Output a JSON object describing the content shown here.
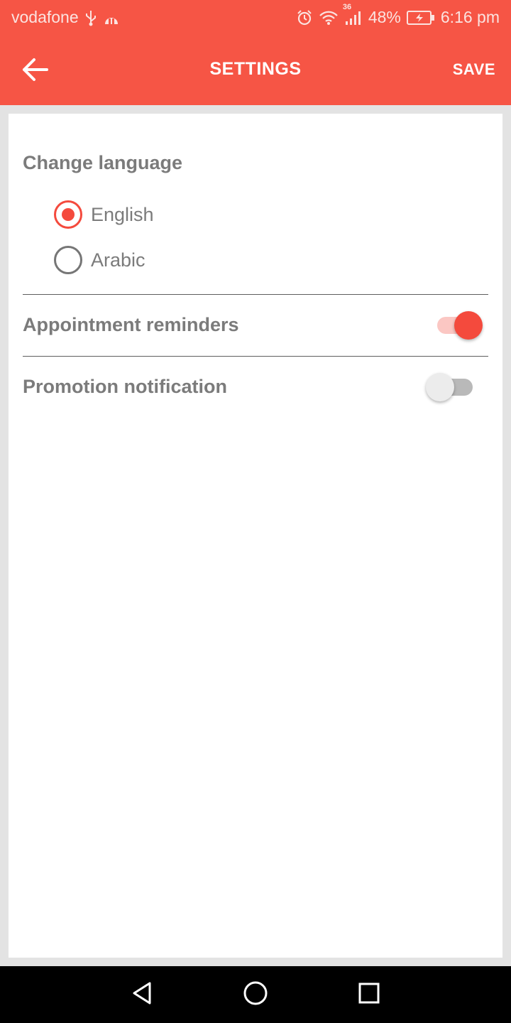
{
  "status_bar": {
    "carrier": "vodafone",
    "network": "36",
    "battery": "48%",
    "time": "6:16 pm",
    "icons": [
      "usb-icon",
      "app-notification-icon",
      "alarm-icon",
      "wifi-icon",
      "signal-icon",
      "battery-charging-icon"
    ]
  },
  "app_bar": {
    "title": "SETTINGS",
    "save_label": "SAVE",
    "back_icon": "arrow-left-icon",
    "background": "#f65545"
  },
  "language": {
    "title": "Change language",
    "options": [
      {
        "label": "English",
        "selected": true
      },
      {
        "label": "Arabic",
        "selected": false
      }
    ]
  },
  "settings": [
    {
      "label": "Appointment reminders",
      "enabled": true
    },
    {
      "label": "Promotion notification",
      "enabled": false
    }
  ],
  "nav_bar": {
    "icons": [
      "back-triangle-icon",
      "home-circle-icon",
      "recents-square-icon"
    ]
  },
  "colors": {
    "accent": "#f44a3d",
    "text": "#7b7b7b"
  }
}
